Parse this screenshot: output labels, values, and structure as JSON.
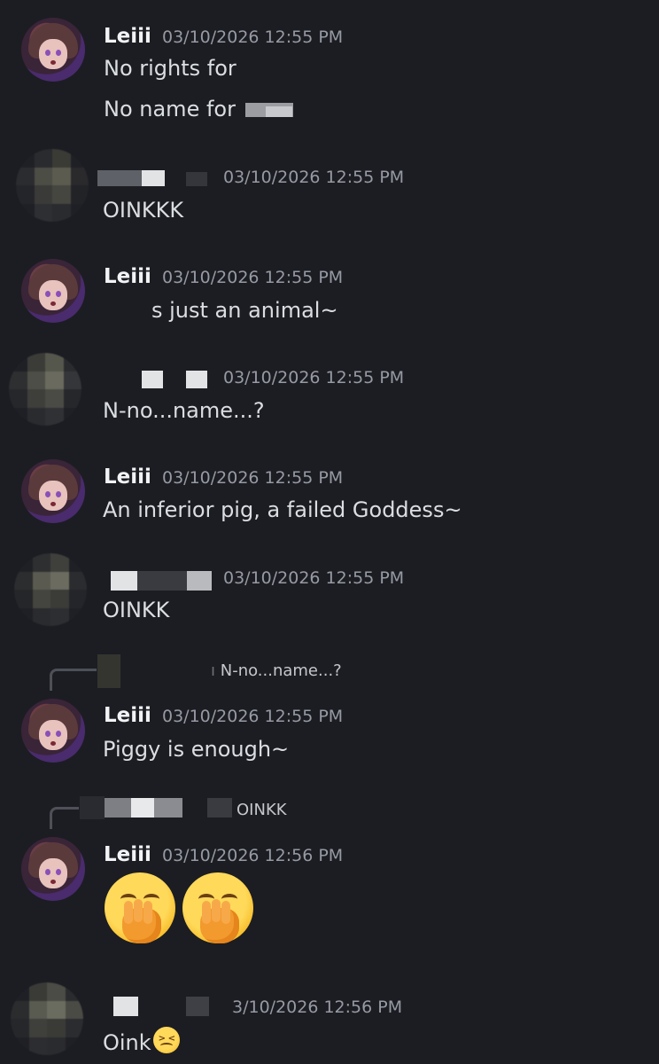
{
  "messages": [
    {
      "author": "Leiii",
      "timestamp": "03/10/2026 12:55 PM",
      "lines": [
        "No rights for",
        "No name for"
      ]
    },
    {
      "author": "",
      "timestamp": "03/10/2026 12:55 PM",
      "lines": [
        "OINKKK"
      ]
    },
    {
      "author": "Leiii",
      "timestamp": "03/10/2026 12:55 PM",
      "lines": [
        "s just an animal~"
      ]
    },
    {
      "author": "",
      "timestamp": "03/10/2026 12:55 PM",
      "lines": [
        "N-no...name...?"
      ]
    },
    {
      "author": "Leiii",
      "timestamp": "03/10/2026 12:55 PM",
      "lines": [
        "An inferior pig, a failed Goddess~"
      ]
    },
    {
      "author": "",
      "timestamp": "03/10/2026 12:55 PM",
      "lines": [
        "OINKK"
      ]
    },
    {
      "author": "Leiii",
      "timestamp": "03/10/2026 12:55 PM",
      "reply_to": "N-no...name...?",
      "lines": [
        "Piggy is enough~"
      ]
    },
    {
      "author": "Leiii",
      "timestamp": "03/10/2026 12:56 PM",
      "reply_to": "OINKK",
      "lines": []
    },
    {
      "author": "",
      "timestamp": "3/10/2026 12:56 PM",
      "lines": [
        "Oink"
      ]
    }
  ],
  "icons": {
    "hand_over_mouth": "face-with-hand-over-mouth-emoji",
    "confounded": "confounded-face-emoji"
  },
  "colors": {
    "background": "#1c1d23",
    "timestamp": "#969aa3",
    "text": "#dbdee1"
  }
}
